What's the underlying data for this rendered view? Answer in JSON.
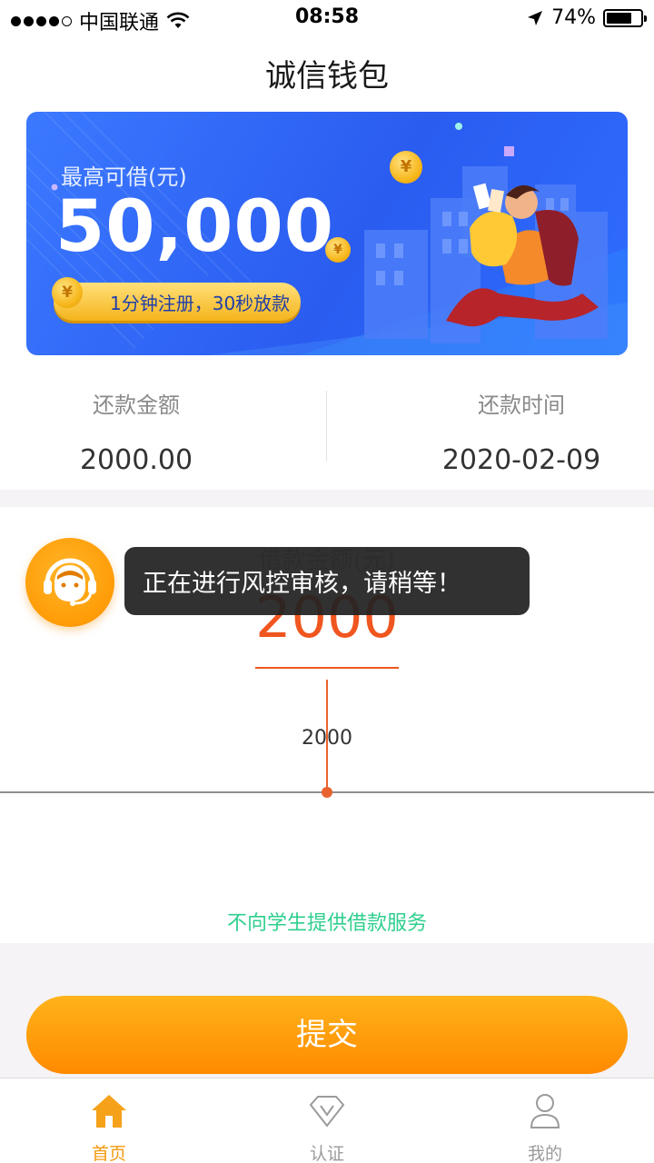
{
  "status_bar": {
    "carrier": "中国联通",
    "time": "08:58",
    "battery": "74%",
    "battery_level": 0.74,
    "icons": [
      "signal-dots-icon",
      "wifi-icon",
      "location-arrow-icon",
      "battery-icon"
    ]
  },
  "nav": {
    "title": "诚信钱包"
  },
  "banner": {
    "subtitle": "最高可借(元)",
    "amount": "50,000",
    "pill_text": "1分钟注册，30秒放款",
    "coin_symbol": "¥"
  },
  "repayment": {
    "amount_label": "还款金额",
    "amount_value": "2000.00",
    "time_label": "还款时间",
    "time_value": "2020-02-09"
  },
  "loan": {
    "label": "借款金额(元)",
    "value": "2000",
    "slider_value": "2000",
    "notice": "不向学生提供借款服务"
  },
  "submit": {
    "label": "提交"
  },
  "toast": {
    "message": "正在进行风控审核，请稍等！"
  },
  "tabbar": {
    "items": [
      {
        "label": "首页",
        "icon": "home-icon",
        "active": true
      },
      {
        "label": "认证",
        "icon": "diamond-icon",
        "active": false
      },
      {
        "label": "我的",
        "icon": "person-icon",
        "active": false
      }
    ]
  },
  "colors": {
    "accent_orange": "#ff9a06",
    "amount_red": "#f0561f",
    "notice_green": "#2fcf8e",
    "banner_blue": "#2f6dff"
  }
}
